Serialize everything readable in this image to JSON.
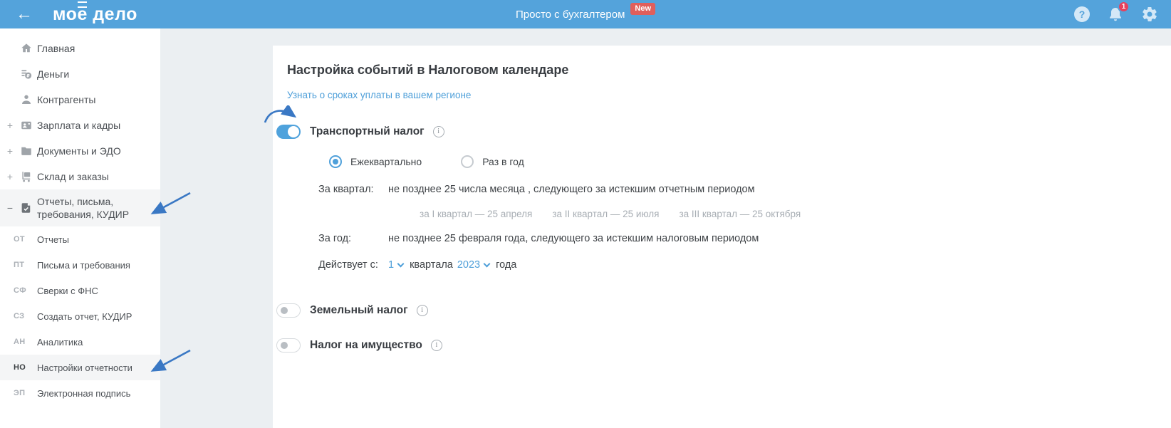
{
  "topbar": {
    "back": "←",
    "logo": {
      "pre": "мо",
      "accent": "е",
      "post": " дело"
    },
    "promo": {
      "text": "Просто с бухгалтером",
      "badge": "New"
    },
    "help": "?",
    "notification_count": "1"
  },
  "sidebar": {
    "items": [
      {
        "label": "Главная"
      },
      {
        "label": "Деньги"
      },
      {
        "label": "Контрагенты"
      },
      {
        "label": "Зарплата и кадры",
        "expander": "+"
      },
      {
        "label": "Документы и ЭДО",
        "expander": "+"
      },
      {
        "label": "Склад и заказы",
        "expander": "+"
      },
      {
        "label": "Отчеты, письма, требования, КУДИР",
        "expander": "−"
      }
    ],
    "subitems": [
      {
        "abbr": "ОТ",
        "label": "Отчеты"
      },
      {
        "abbr": "ПТ",
        "label": "Письма и требования"
      },
      {
        "abbr": "СФ",
        "label": "Сверки с ФНС"
      },
      {
        "abbr": "СЗ",
        "label": "Создать отчет, КУДИР"
      },
      {
        "abbr": "АН",
        "label": "Аналитика"
      },
      {
        "abbr": "НО",
        "label": "Настройки отчетности"
      },
      {
        "abbr": "ЭП",
        "label": "Электронная подпись"
      }
    ]
  },
  "main": {
    "title": "Настройка событий в Налоговом календаре",
    "region_link": "Узнать о сроках уплаты в вашем регионе",
    "info_icon": "i",
    "transport": {
      "name": "Транспортный налог",
      "enabled": true,
      "radio_quarterly": "Ежеквартально",
      "radio_yearly": "Раз в год",
      "quarter_label": "За квартал:",
      "quarter_value": "не позднее 25 числа месяца , следующего за истекшим отчетным периодом",
      "quarter_details": [
        "за I квартал — 25 апреля",
        "за II квартал — 25 июля",
        "за III квартал — 25 октября"
      ],
      "year_label": "За год:",
      "year_value": "не позднее 25 февраля года, следующего за истекшим налоговым периодом",
      "valid_from_label": "Действует с:",
      "valid_quarter_value": "1",
      "valid_quarter_word": "квартала",
      "valid_year_value": "2023",
      "valid_year_word": "года"
    },
    "land_tax": {
      "name": "Земельный налог",
      "enabled": false
    },
    "property_tax": {
      "name": "Налог на имущество",
      "enabled": false
    }
  },
  "colors": {
    "topbar_blue": "#54A3DB",
    "accent_blue": "#4E9FD9",
    "badge_red": "#E05F5C",
    "notification_red": "#E8415C",
    "annotation_arrow_blue": "#3A78C4",
    "active_row_bg": "#F4F5F6",
    "gutter_gray": "#EBEFF2"
  }
}
